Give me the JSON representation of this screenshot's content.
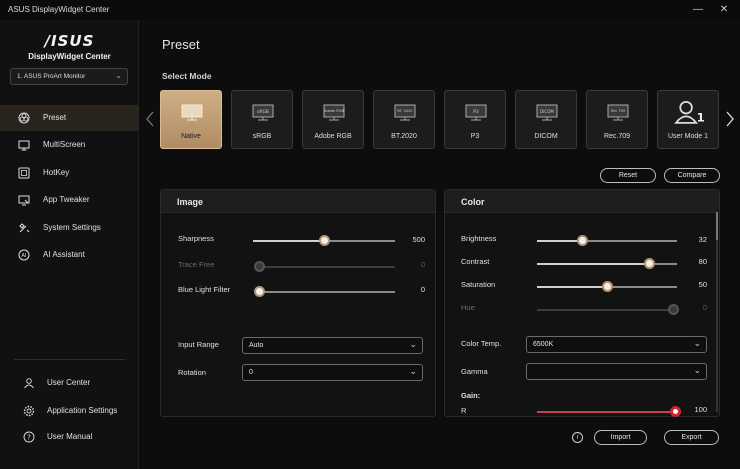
{
  "window": {
    "title": "ASUS DisplayWidget Center",
    "minimize": "—",
    "close": "✕"
  },
  "sidebar": {
    "brand": "/ISUS",
    "product": "DisplayWidget Center",
    "monitor": "1. ASUS ProArt Monitor",
    "items": [
      {
        "label": "Preset",
        "icon": "preset-icon",
        "active": true
      },
      {
        "label": "MultiScreen",
        "icon": "multiscreen-icon"
      },
      {
        "label": "HotKey",
        "icon": "hotkey-icon"
      },
      {
        "label": "App Tweaker",
        "icon": "app-tweaker-icon"
      },
      {
        "label": "System Settings",
        "icon": "system-settings-icon"
      },
      {
        "label": "AI Assistant",
        "icon": "ai-assistant-icon"
      }
    ],
    "bottom": [
      {
        "label": "User Center",
        "icon": "user-icon"
      },
      {
        "label": "Application Settings",
        "icon": "gear-icon"
      },
      {
        "label": "User Manual",
        "icon": "help-icon"
      }
    ]
  },
  "main": {
    "title": "Preset",
    "select_mode": "Select Mode",
    "modes": [
      {
        "label": "Native",
        "thumb": "",
        "active": true
      },
      {
        "label": "sRGB",
        "thumb": "sRGB"
      },
      {
        "label": "Adobe RGB",
        "thumb": "Adobe RGB"
      },
      {
        "label": "BT.2020",
        "thumb": "BT. 2020"
      },
      {
        "label": "P3",
        "thumb": "P3"
      },
      {
        "label": "DICOM",
        "thumb": "DICOM"
      },
      {
        "label": "Rec.709",
        "thumb": "Rec 709"
      },
      {
        "label": "User Mode 1",
        "thumb": "1"
      }
    ],
    "reset": "Reset",
    "compare": "Compare",
    "import": "Import",
    "export": "Export",
    "info": "i"
  },
  "image_panel": {
    "title": "Image",
    "sharpness": {
      "label": "Sharpness",
      "value": "500",
      "fraction": 0.5
    },
    "trace_free": {
      "label": "Trace Free",
      "value": "0",
      "fraction": 0.0
    },
    "blue_light": {
      "label": "Blue Light Filter",
      "value": "0",
      "fraction": 0.0
    },
    "input_range": {
      "label": "Input Range",
      "value": "Auto"
    },
    "rotation": {
      "label": "Rotation",
      "value": "0"
    }
  },
  "color_panel": {
    "title": "Color",
    "brightness": {
      "label": "Brightness",
      "value": "32",
      "fraction": 0.32
    },
    "contrast": {
      "label": "Contrast",
      "value": "80",
      "fraction": 0.8
    },
    "saturation": {
      "label": "Saturation",
      "value": "50",
      "fraction": 0.5
    },
    "hue": {
      "label": "Hue",
      "value": "0",
      "fraction": 1.0
    },
    "color_temp": {
      "label": "Color Temp.",
      "value": "6500K"
    },
    "gamma": {
      "label": "Gamma",
      "value": ""
    },
    "gain": {
      "label": "Gain:",
      "r_label": "R",
      "r_value": "100",
      "r_fraction": 1.0
    }
  },
  "colors": {
    "accent": "#c9a77f",
    "background": "#0d0d0d",
    "gain_red": "#d0242f"
  }
}
